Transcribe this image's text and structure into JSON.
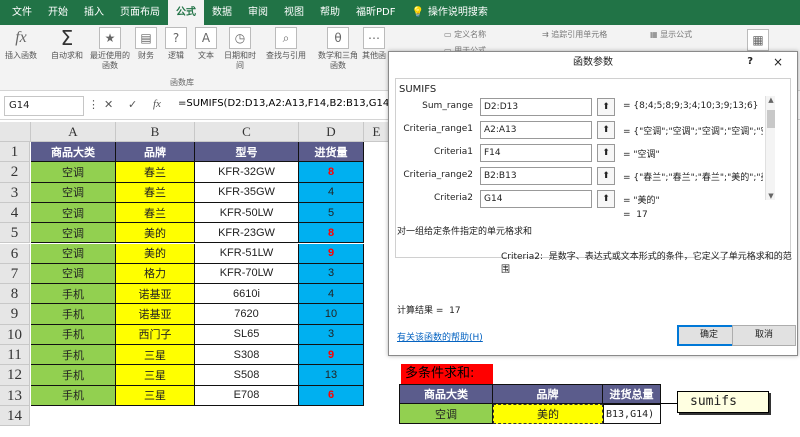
{
  "tabs": [
    "文件",
    "开始",
    "插入",
    "页面布局",
    "公式",
    "数据",
    "审阅",
    "视图",
    "帮助",
    "福昕PDF",
    "操作说明搜索"
  ],
  "active_tab": "公式",
  "ribbon": {
    "insert_function": "插入函数",
    "autosum": "自动求和",
    "recent": "最近使用的函数",
    "finance": "财务",
    "logic": "逻辑",
    "text": "文本",
    "datetime": "日期和时间",
    "lookup": "查找与引用",
    "math": "数学和三角函数",
    "more": "其他函",
    "group_label": "函数库",
    "define_name": "定义名称",
    "use_in_formula": "用于公式",
    "trace_precedents": "追踪引用单元格",
    "show_formulas": "显示公式"
  },
  "formula_bar": {
    "name_box": "G14",
    "formula": "=SUMIFS(D2:D13,A2:A13,F14,B2:B13,G14)"
  },
  "columns": [
    "A",
    "B",
    "C",
    "D",
    "E"
  ],
  "rows": [
    "1",
    "2",
    "3",
    "4",
    "5",
    "6",
    "7",
    "8",
    "9",
    "10",
    "11",
    "12",
    "13",
    "14"
  ],
  "table": {
    "headers": [
      "商品大类",
      "品牌",
      "型号",
      "进货量"
    ],
    "data": [
      [
        "空调",
        "春兰",
        "KFR-32GW",
        "8"
      ],
      [
        "空调",
        "春兰",
        "KFR-35GW",
        "4"
      ],
      [
        "空调",
        "春兰",
        "KFR-50LW",
        "5"
      ],
      [
        "空调",
        "美的",
        "KFR-23GW",
        "8"
      ],
      [
        "空调",
        "美的",
        "KFR-51LW",
        "9"
      ],
      [
        "空调",
        "格力",
        "KFR-70LW",
        "3"
      ],
      [
        "手机",
        "诺基亚",
        "6610i",
        "4"
      ],
      [
        "手机",
        "诺基亚",
        "7620",
        "10"
      ],
      [
        "手机",
        "西门子",
        "SL65",
        "3"
      ],
      [
        "手机",
        "三星",
        "S308",
        "9"
      ],
      [
        "手机",
        "三星",
        "S508",
        "13"
      ],
      [
        "手机",
        "三星",
        "E708",
        "6"
      ]
    ]
  },
  "dialog": {
    "title": "函数参数",
    "help_mark": "?",
    "close": "×",
    "function_name": "SUMIFS",
    "args": [
      {
        "label": "Sum_range",
        "value": "D2:D13",
        "result": "{8;4;5;8;9;3;4;10;3;9;13;6}"
      },
      {
        "label": "Criteria_range1",
        "value": "A2:A13",
        "result": "{\"空调\";\"空调\";\"空调\";\"空调\";\"空..."
      },
      {
        "label": "Criteria1",
        "value": "F14",
        "result": "\"空调\""
      },
      {
        "label": "Criteria_range2",
        "value": "B2:B13",
        "result": "{\"春兰\";\"春兰\";\"春兰\";\"美的\";\"美的..."
      },
      {
        "label": "Criteria2",
        "value": "G14",
        "result": "\"美的\""
      }
    ],
    "equals": "=",
    "result_value": "17",
    "description": "对一组给定条件指定的单元格求和",
    "arg_name": "Criteria2:",
    "arg_description": "是数字、表达式或文本形式的条件，它定义了单元格求和的范围",
    "calc_result_label": "计算结果 =",
    "calc_result_value": "17",
    "help_link": "有关该函数的帮助(H)",
    "ok": "确定",
    "cancel": "取消"
  },
  "multi": {
    "title": "多条件求和:",
    "headers": [
      "商品大类",
      "品牌",
      "进货总量"
    ],
    "values": [
      "空调",
      "美的",
      "B13,G14)"
    ]
  },
  "tooltip": "sumifs"
}
